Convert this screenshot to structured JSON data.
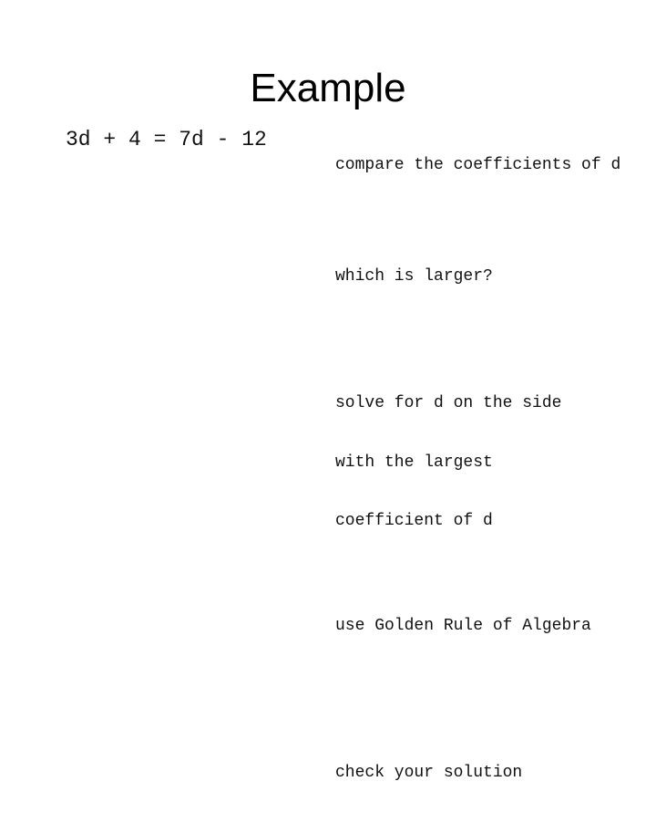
{
  "slide": {
    "title": "Example",
    "background_color": "#ffffff",
    "text_color": "#111111",
    "title_color": "#000000"
  },
  "equation": {
    "text": "3d + 4 = 7d - 12"
  },
  "notes": {
    "block1": {
      "line1": "compare the coefficients of d"
    },
    "block2": {
      "line1": "which is larger?"
    },
    "block3": {
      "line1": "solve for d on the side",
      "line2": "with the largest",
      "line3": "coefficient of d"
    },
    "block4": {
      "line1": "use Golden Rule of Algebra"
    },
    "block5": {
      "line1": "check your solution"
    }
  }
}
